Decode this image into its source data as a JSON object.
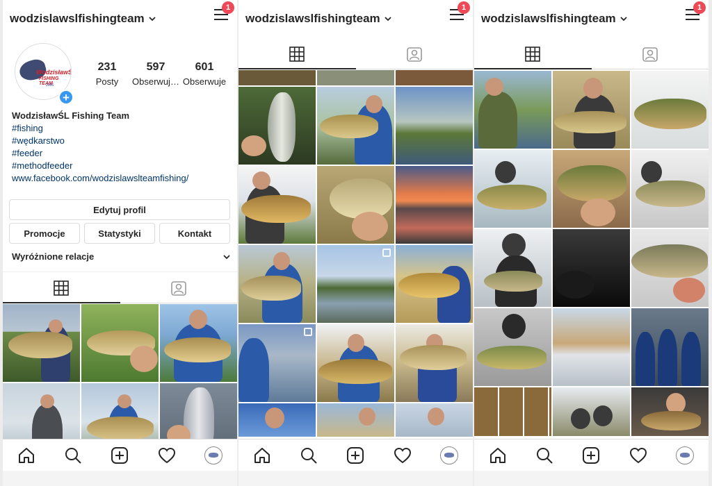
{
  "account": {
    "username": "wodzislawslfishingteam",
    "notifications": "1"
  },
  "profile": {
    "posts_count": "231",
    "posts_label": "Posty",
    "followers_count": "597",
    "followers_label": "Obserwuj…",
    "following_count": "601",
    "following_label": "Obserwuje",
    "logo_text_1": "WodzisławŚL",
    "logo_text_2": "FISHING TEAM",
    "logo_text_3": "2006",
    "plus_icon": "+",
    "display_name": "WodzisławŚL Fishing Team",
    "bio_lines": [
      "#fishing",
      "#wędkarstwo",
      "#feeder",
      "#methodfeeder"
    ],
    "link": "www.facebook.com/wodzislawslteamfishing/",
    "edit_profile": "Edytuj profil",
    "promotions": "Promocje",
    "statistics": "Statystyki",
    "contact": "Kontakt",
    "highlights": "Wyróżnione relacje"
  },
  "icons": {
    "caret": "chevron-down-icon",
    "menu": "hamburger-menu-icon",
    "grid": "grid-icon",
    "tagged": "tagged-person-icon",
    "home": "home-icon",
    "search": "search-icon",
    "add": "add-post-icon",
    "heart": "heart-icon",
    "profile": "profile-avatar-icon"
  },
  "colors": {
    "accent": "#3897f0",
    "badge": "#ed4956",
    "link": "#003569"
  }
}
